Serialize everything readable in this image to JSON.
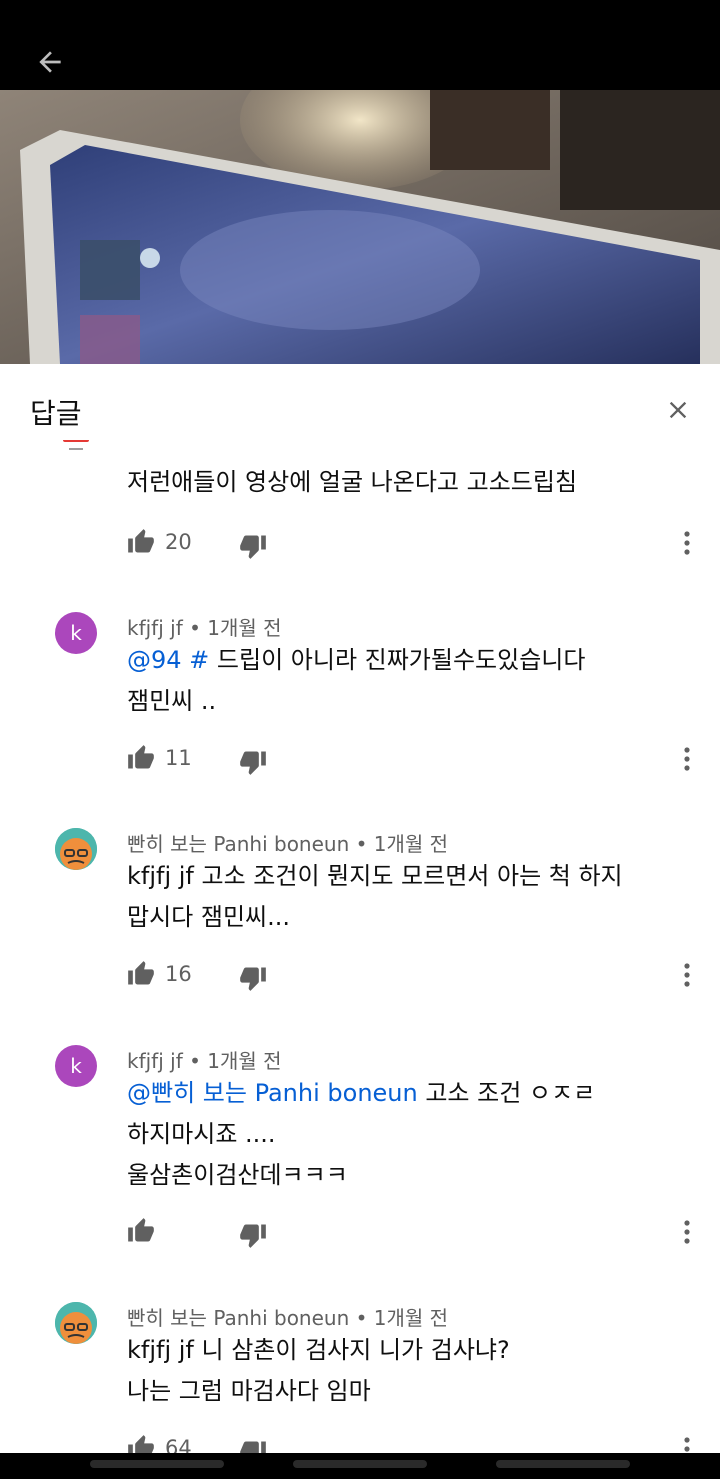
{
  "header": {
    "title": "답글"
  },
  "comments": [
    {
      "text_lines": [
        "저런애들이 영상에 얼굴 나온다고 고소드립침"
      ],
      "likes": "20"
    },
    {
      "author": "kfjfj jf",
      "time": "1개월 전",
      "avatar_letter": "k",
      "mention": "@94 #",
      "text_first": " 드립이 아니라 진짜가될수도있습니다",
      "text_lines": [
        "잼민씨 .."
      ],
      "likes": "11"
    },
    {
      "author": "빤히 보는 Panhi boneun",
      "time": "1개월 전",
      "text_lines": [
        "kfjfj jf 고소 조건이 뭔지도 모르면서 아는 척 하지",
        "맙시다 잼민씨..."
      ],
      "likes": "16"
    },
    {
      "author": "kfjfj jf",
      "time": "1개월 전",
      "avatar_letter": "k",
      "mention": "@빤히 보는 Panhi boneun",
      "text_first": " 고소 조건 ㅇㅈㄹ",
      "text_lines": [
        "하지마시죠 ....",
        "울삼촌이검산데ㅋㅋㅋ"
      ],
      "likes": ""
    },
    {
      "author": "빤히 보는 Panhi boneun",
      "time": "1개월 전",
      "text_lines": [
        "kfjfj jf 니 삼촌이 검사지 니가 검사냐?",
        "나는 그럼 마검사다 임마"
      ],
      "likes": "64"
    }
  ],
  "icons": {
    "back": "arrow-left-icon",
    "close": "close-icon",
    "like": "thumb-up-icon",
    "dislike": "thumb-down-icon",
    "more": "more-vert-icon"
  },
  "colors": {
    "mention": "#065fd4",
    "avatar_k": "#ab47bc",
    "meta": "#606060"
  }
}
